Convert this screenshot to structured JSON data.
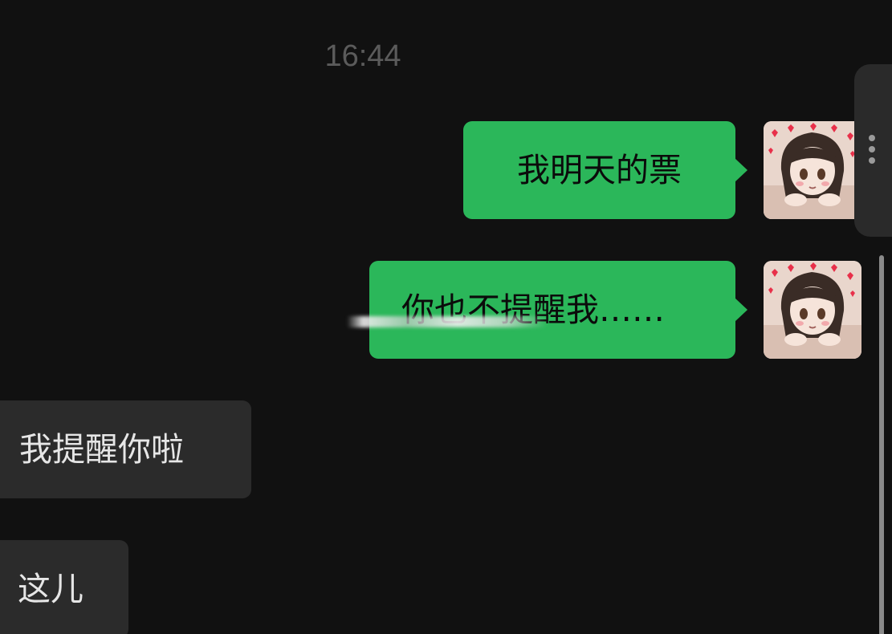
{
  "chat": {
    "timestamp": "16:44",
    "messages": [
      {
        "direction": "outgoing",
        "text": "我明天的票"
      },
      {
        "direction": "outgoing",
        "text": "你也不提醒我……"
      },
      {
        "direction": "incoming",
        "text": "我提醒你啦"
      },
      {
        "direction": "incoming",
        "text": "这儿"
      }
    ]
  },
  "avatar": {
    "icon": "anime-girl-avatar-icon"
  },
  "side_panel": {
    "icon": "vertical-dots-icon"
  },
  "colors": {
    "background": "#111111",
    "outgoing_bubble": "#2bb75a",
    "incoming_bubble": "#2b2b2b",
    "timestamp": "#5b5b5b"
  }
}
